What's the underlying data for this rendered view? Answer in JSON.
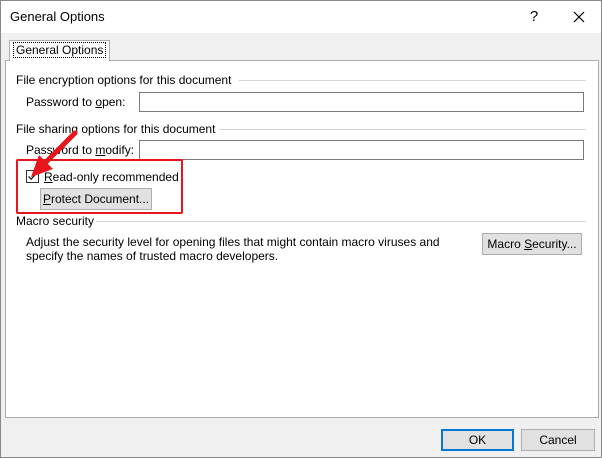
{
  "window": {
    "title": "General Options",
    "help_glyph": "?"
  },
  "tab": {
    "label": "General Options"
  },
  "encryption": {
    "group_label": "File encryption options for this document",
    "password_label_pre": "Password to ",
    "password_label_key": "o",
    "password_label_post": "pen:",
    "password_value": ""
  },
  "sharing": {
    "group_label": "File sharing options for this document",
    "modify_label_pre": "Password to ",
    "modify_label_key": "m",
    "modify_label_post": "odify:",
    "modify_value": "",
    "readonly_key": "R",
    "readonly_rest": "ead-only recommended",
    "readonly_checked": true,
    "protect_key": "P",
    "protect_rest": "rotect Document..."
  },
  "macro": {
    "group_label": "Macro security",
    "description": "Adjust the security level for opening files that might contain macro viruses and specify the names of trusted macro developers.",
    "button_pre": "Macro ",
    "button_key": "S",
    "button_post": "ecurity..."
  },
  "footer": {
    "ok_label": "OK",
    "cancel_label": "Cancel"
  },
  "annotation": {
    "color": "#e8161c"
  },
  "colors": {
    "accent": "#0078d7"
  }
}
